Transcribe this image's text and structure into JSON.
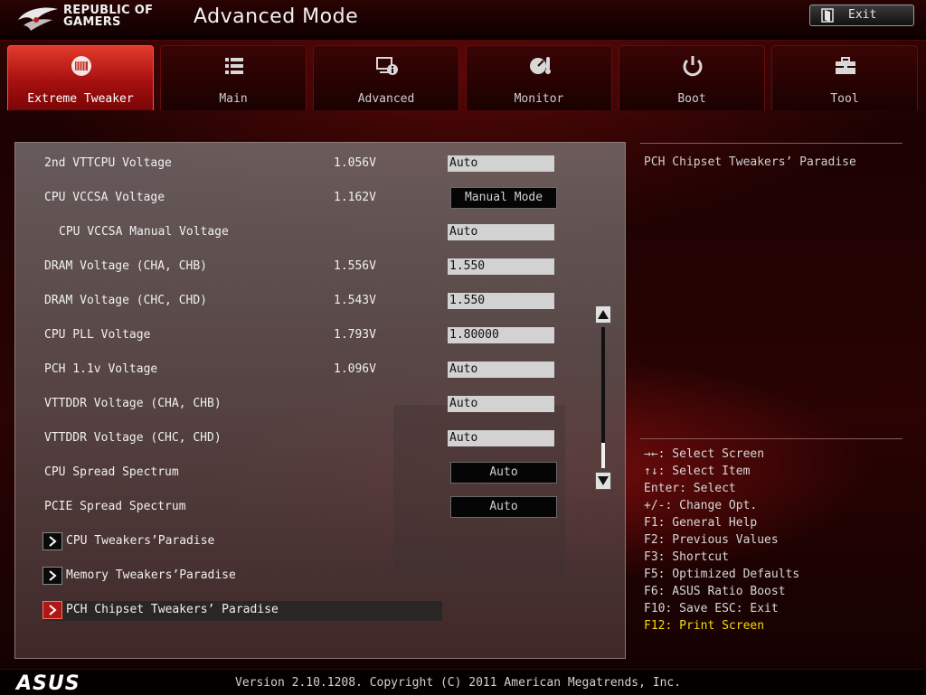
{
  "header": {
    "brand_line1": "REPUBLIC OF",
    "brand_line2": "GAMERS",
    "title": "Advanced Mode",
    "exit_label": "Exit"
  },
  "tabs": [
    {
      "label": "Extreme Tweaker",
      "icon": "extreme-tweaker-icon",
      "active": true
    },
    {
      "label": "Main",
      "icon": "list-icon",
      "active": false
    },
    {
      "label": "Advanced",
      "icon": "advanced-settings-icon",
      "active": false
    },
    {
      "label": "Monitor",
      "icon": "thermometer-gauge-icon",
      "active": false
    },
    {
      "label": "Boot",
      "icon": "power-icon",
      "active": false
    },
    {
      "label": "Tool",
      "icon": "toolbox-icon",
      "active": false
    }
  ],
  "settings": [
    {
      "name": "2nd VTTCPU Voltage",
      "value": "1.056V",
      "control": "Auto",
      "control_type": "field"
    },
    {
      "name": "CPU VCCSA Voltage",
      "value": "1.162V",
      "control": "Manual Mode",
      "control_type": "button"
    },
    {
      "name": "CPU VCCSA Manual Voltage",
      "value": "",
      "control": "Auto",
      "control_type": "field"
    },
    {
      "name": "DRAM Voltage (CHA, CHB)",
      "value": "1.556V",
      "control": "1.550",
      "control_type": "field"
    },
    {
      "name": "DRAM Voltage (CHC, CHD)",
      "value": "1.543V",
      "control": "1.550",
      "control_type": "field"
    },
    {
      "name": "CPU PLL Voltage",
      "value": "1.793V",
      "control": "1.80000",
      "control_type": "field"
    },
    {
      "name": "PCH 1.1v Voltage",
      "value": "1.096V",
      "control": "Auto",
      "control_type": "field"
    },
    {
      "name": "VTTDDR Voltage (CHA, CHB)",
      "value": "",
      "control": "Auto",
      "control_type": "field"
    },
    {
      "name": "VTTDDR Voltage (CHC, CHD)",
      "value": "",
      "control": "Auto",
      "control_type": "field"
    },
    {
      "name": "CPU Spread Spectrum",
      "value": "",
      "control": "Auto",
      "control_type": "button"
    },
    {
      "name": "PCIE Spread Spectrum",
      "value": "",
      "control": "Auto",
      "control_type": "button"
    }
  ],
  "submenus": [
    {
      "label": "CPU Tweakers’Paradise",
      "selected": false
    },
    {
      "label": "Memory Tweakers’Paradise",
      "selected": false
    },
    {
      "label": "PCH Chipset Tweakers’ Paradise",
      "selected": true
    }
  ],
  "help": {
    "title": "PCH Chipset Tweakers’ Paradise",
    "keys": [
      {
        "text": "→←: Select Screen",
        "highlight": false
      },
      {
        "text": "↑↓: Select Item",
        "highlight": false
      },
      {
        "text": "Enter: Select",
        "highlight": false
      },
      {
        "text": "+/-: Change Opt.",
        "highlight": false
      },
      {
        "text": "F1: General Help",
        "highlight": false
      },
      {
        "text": "F2: Previous Values",
        "highlight": false
      },
      {
        "text": "F3: Shortcut",
        "highlight": false
      },
      {
        "text": "F5: Optimized Defaults",
        "highlight": false
      },
      {
        "text": "F6: ASUS Ratio Boost",
        "highlight": false
      },
      {
        "text": "F10: Save  ESC: Exit",
        "highlight": false
      },
      {
        "text": "F12: Print Screen",
        "highlight": true
      }
    ]
  },
  "footer": {
    "brand": "ASUS",
    "version": "Version 2.10.1208. Copyright (C) 2011 American Megatrends, Inc."
  },
  "scrollbar": {
    "position_fraction": 0.85
  },
  "colors": {
    "accent": "#b01818",
    "highlight_key": "#ffd800",
    "field_bg": "#d2d2d2"
  }
}
